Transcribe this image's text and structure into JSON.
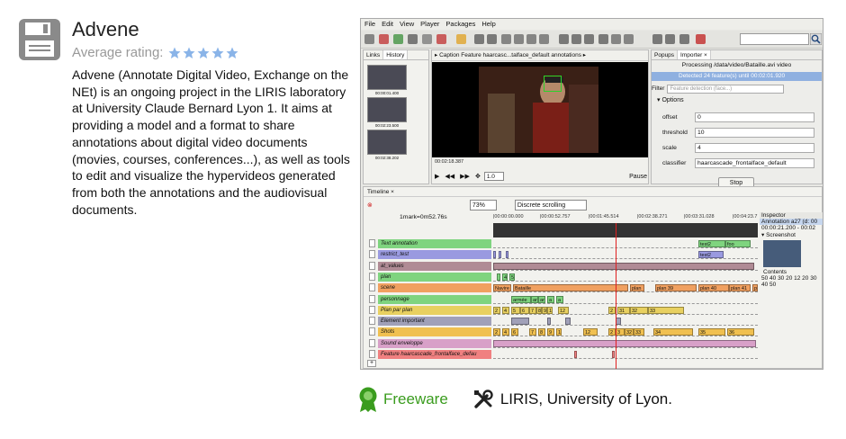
{
  "app": {
    "title": "Advene",
    "rating_label": "Average rating:",
    "rating_stars": 5,
    "rating_color": "#8ab4e8",
    "description": "Advene (Annotate Digital Video, Exchange on the NEt) is an ongoing project in the LIRIS laboratory at University Claude Bernard Lyon 1. It aims at providing a model and a format to share annotations about digital video documents (movies, courses, conferences...), as well as tools to edit and visualize the hypervideos generated from both the annotations and the audiovisual documents.",
    "license": "Freeware",
    "license_color": "#3a9c1e",
    "developer": "LIRIS, University of Lyon."
  },
  "screenshot": {
    "menu": [
      "File",
      "Edit",
      "View",
      "Player",
      "Packages",
      "Help"
    ],
    "left_tabs": [
      "Links",
      "History"
    ],
    "thumb_labels": [
      "00:00:01.400",
      "00:02:23.500",
      "00:02:38.202"
    ],
    "player_header": "▸ Caption Feature haarcasc...talface_default annotations ▸",
    "timecode": "00:02:18.387",
    "rate": "1.0",
    "pause": "Pause",
    "importer_tabs": [
      "Popups",
      "Importer ×"
    ],
    "processing": "Processing /data/video/Bataille.avi video",
    "detected": "Detected 24 feature(s) until 00:02:01.920",
    "filter_label": "Filter",
    "filter_placeholder": "Feature detection (face...)",
    "options_label": "Options",
    "options": [
      {
        "label": "offset",
        "value": "0"
      },
      {
        "label": "threshold",
        "value": "10"
      },
      {
        "label": "scale",
        "value": "4"
      },
      {
        "label": "classifier",
        "value": "haarcascade_frontalface_default"
      }
    ],
    "stop": "Stop",
    "timeline_tab": "Timeline ×",
    "zoom": "73%",
    "scrolling": "Discrete scrolling",
    "mark": "1mark=0m52.76s",
    "ruler": [
      "00:00:00.000",
      "00:00:52.757",
      "00:01:45.514",
      "00:02:38.271",
      "00:03:31.028",
      "00:04:23.7"
    ],
    "tracks": [
      {
        "name": "Text annotation",
        "color": "#7fd47f"
      },
      {
        "name": "restrict_test",
        "color": "#9a9ae0"
      },
      {
        "name": "at_values",
        "color": "#b08b95"
      },
      {
        "name": "plan",
        "color": "#7fd47f"
      },
      {
        "name": "scene",
        "color": "#f0a060"
      },
      {
        "name": "personnage",
        "color": "#7fd47f"
      },
      {
        "name": "Plan par plan",
        "color": "#e8d060"
      },
      {
        "name": "Element important",
        "color": "#a0a0b8"
      },
      {
        "name": "Shots",
        "color": "#f0c050"
      },
      {
        "name": "Sound enveloppe",
        "color": "#d8a0c8"
      },
      {
        "name": "Feature haarcascade_frontalface_defau",
        "color": "#f08080"
      }
    ],
    "seg_labels": {
      "text": [
        "test2",
        "foo"
      ],
      "restrict": [
        "test2"
      ],
      "plan": [
        "4",
        "5"
      ],
      "scene": [
        "Navire",
        "Bataille",
        "plan",
        "plan 39",
        "plan 40",
        "plan 41",
        "p"
      ],
      "personnage": [
        "armée",
        "ar",
        "ar",
        "a",
        "a"
      ],
      "planpar": [
        "2",
        "4",
        "5",
        "6",
        "7",
        "8",
        "9",
        "1",
        "12",
        "2",
        "31",
        "32",
        "33"
      ],
      "shots": [
        "2",
        "4",
        "6",
        "7",
        "8",
        "9",
        "1",
        "12",
        "2",
        "3",
        "32",
        "33",
        "34",
        "35",
        "36"
      ]
    },
    "inspector": {
      "title": "Inspector",
      "annotation": "Annotation a27 (d: 00",
      "range": "00:00:21.200 - 00:02",
      "screenshot_label": "Screenshot",
      "contents_label": "Contents",
      "contents": "50 40 30 20 12 20 30 40 50"
    }
  }
}
